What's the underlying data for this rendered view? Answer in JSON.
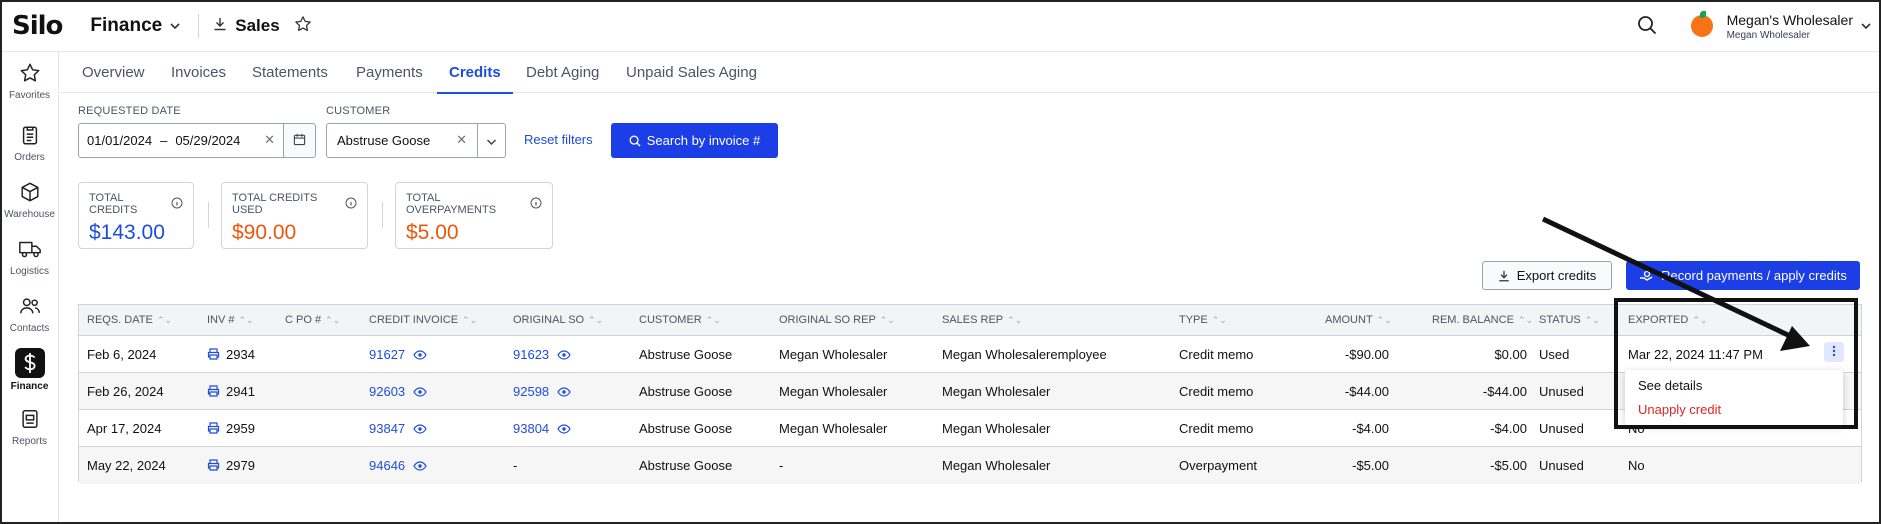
{
  "app": {
    "logo": "Silo",
    "module": "Finance",
    "breadcrumb": "Sales"
  },
  "account": {
    "name": "Megan's Wholesaler",
    "sub": "Megan Wholesaler"
  },
  "sidebar": [
    {
      "label": "Favorites",
      "icon": "star-icon"
    },
    {
      "label": "Orders",
      "icon": "clipboard-icon"
    },
    {
      "label": "Warehouse",
      "icon": "box-icon"
    },
    {
      "label": "Logistics",
      "icon": "truck-icon"
    },
    {
      "label": "Contacts",
      "icon": "users-icon"
    },
    {
      "label": "Finance",
      "icon": "dollar-icon",
      "active": true
    },
    {
      "label": "Reports",
      "icon": "report-icon"
    }
  ],
  "tabs": [
    "Overview",
    "Invoices",
    "Statements",
    "Payments",
    "Credits",
    "Debt Aging",
    "Unpaid Sales Aging"
  ],
  "active_tab": "Credits",
  "filters": {
    "date_label": "Requested date",
    "date_from": "01/01/2024",
    "date_sep": "–",
    "date_to": "05/29/2024",
    "customer_label": "Customer",
    "customer_value": "Abstruse Goose",
    "reset": "Reset filters",
    "search_btn": "Search by invoice #"
  },
  "kpis": [
    {
      "label": "Total credits",
      "value": "$143.00",
      "color": "#1d4ed8"
    },
    {
      "label": "Total credits used",
      "value": "$90.00",
      "color": "#ea580c"
    },
    {
      "label": "Total overpayments",
      "value": "$5.00",
      "color": "#ea580c"
    }
  ],
  "actions": {
    "export": "Export credits",
    "record": "Record payments / apply credits"
  },
  "table": {
    "headers": [
      "Reqs. date",
      "Inv #",
      "C PO #",
      "Credit invoice",
      "Original SO",
      "Customer",
      "Original SO rep",
      "Sales rep",
      "Type",
      "Amount",
      "Rem. balance",
      "Status",
      "Exported"
    ],
    "rows": [
      {
        "date": "Feb 6, 2024",
        "inv": "2934",
        "cpo": "",
        "credit": "91627",
        "so": "91623",
        "customer": "Abstruse Goose",
        "sorep": "Megan Wholesaler",
        "rep": "Megan Wholesaleremployee",
        "type": "Credit memo",
        "amount": "-$90.00",
        "balance": "$0.00",
        "status": "Used",
        "exported": "Mar 22, 2024 11:47 PM"
      },
      {
        "date": "Feb 26, 2024",
        "inv": "2941",
        "cpo": "",
        "credit": "92603",
        "so": "92598",
        "customer": "Abstruse Goose",
        "sorep": "Megan Wholesaler",
        "rep": "Megan Wholesaler",
        "type": "Credit memo",
        "amount": "-$44.00",
        "balance": "-$44.00",
        "status": "Unused",
        "exported": ""
      },
      {
        "date": "Apr 17, 2024",
        "inv": "2959",
        "cpo": "",
        "credit": "93847",
        "so": "93804",
        "customer": "Abstruse Goose",
        "sorep": "Megan Wholesaler",
        "rep": "Megan Wholesaler",
        "type": "Credit memo",
        "amount": "-$4.00",
        "balance": "-$4.00",
        "status": "Unused",
        "exported": "No"
      },
      {
        "date": "May 22, 2024",
        "inv": "2979",
        "cpo": "",
        "credit": "94646",
        "so": "-",
        "customer": "Abstruse Goose",
        "sorep": "-",
        "rep": "Megan Wholesaler",
        "type": "Overpayment",
        "amount": "-$5.00",
        "balance": "-$5.00",
        "status": "Unused",
        "exported": "No"
      }
    ]
  },
  "menu": {
    "details": "See details",
    "unapply": "Unapply credit",
    "unapply_color": "#dc2626"
  }
}
